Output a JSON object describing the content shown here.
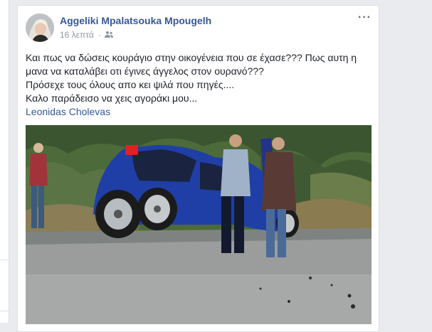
{
  "post": {
    "author_name": "Aggeliki Mpalatsouka Mpougelh",
    "timestamp": "16 λεπτά",
    "audience_icon": "friends-icon",
    "options_icon": "more-options-icon",
    "text_lines": [
      "Και πως να δώσεις κουράγιο στην οικογένεια που σε έχασε??? Πως αυτη η",
      "μανα να καταλάβει οτι έγινες άγγελος στον ουρανό???",
      "Πρόσεχε τους όλους απο κει ψιλά που πηγές....",
      "Καλο παράδεισο να χεις αγοράκι μου..."
    ],
    "tagged_person": "Leonidas Cholevas",
    "photo_subject": "car-crash-photo"
  },
  "colors": {
    "link": "#365899",
    "text": "#1d2129",
    "meta": "#90949c",
    "background": "#e9ebee",
    "car": "#1f3fa6"
  }
}
